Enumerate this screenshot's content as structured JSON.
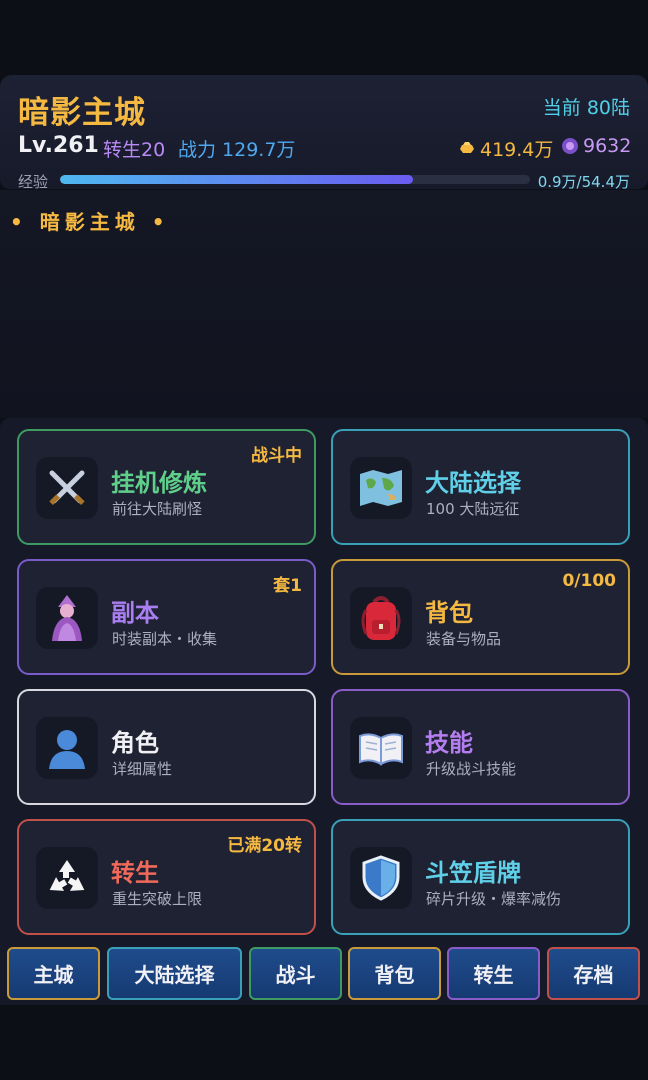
{
  "header": {
    "city_title": "暗影主城",
    "continent": "当前 80陆",
    "level": "Lv.261",
    "rebirth": "转生20",
    "power": "战力 129.7万",
    "gold": "419.4万",
    "gems": "9632",
    "exp_label": "经验",
    "exp_text": "0.9万/54.4万",
    "exp_progress": 0.75
  },
  "scene": {
    "title": "• 暗影主城 •"
  },
  "cards": [
    {
      "title": "挂机修炼",
      "sub": "前往大陆刷怪",
      "badge": "战斗中",
      "icon": "crossed-swords-icon",
      "color": "#5fd08a",
      "border": "#3f9a62"
    },
    {
      "title": "大陆选择",
      "sub": "100 大陆远征",
      "badge": "",
      "icon": "world-map-icon",
      "color": "#5fd0e8",
      "border": "#3aa0b8"
    },
    {
      "title": "副本",
      "sub": "时装副本・收集",
      "badge": "套1",
      "icon": "mage-character-icon",
      "color": "#a97ef0",
      "border": "#7a5cc8"
    },
    {
      "title": "背包",
      "sub": "装备与物品",
      "badge": "0/100",
      "icon": "backpack-icon",
      "color": "#f5b942",
      "border": "#c99a3a"
    },
    {
      "title": "角色",
      "sub": "详细属性",
      "badge": "",
      "icon": "person-silhouette-icon",
      "color": "#f0f0f5",
      "border": "#d8d8e0"
    },
    {
      "title": "技能",
      "sub": "升级战斗技能",
      "badge": "",
      "icon": "open-book-icon",
      "color": "#b57ef0",
      "border": "#8a5cc8"
    },
    {
      "title": "转生",
      "sub": "重生突破上限",
      "badge": "已满20转",
      "icon": "recycle-icon",
      "color": "#f06a5a",
      "border": "#c0504a"
    },
    {
      "title": "斗笠盾牌",
      "sub": "碎片升级・爆率减伤",
      "badge": "",
      "icon": "shield-icon",
      "color": "#5fd0e8",
      "border": "#3aa0b8"
    }
  ],
  "nav": [
    {
      "label": "主城",
      "border": "#c99a3a"
    },
    {
      "label": "大陆选择",
      "border": "#3aa0b8"
    },
    {
      "label": "战斗",
      "border": "#3f9a62"
    },
    {
      "label": "背包",
      "border": "#c99a3a"
    },
    {
      "label": "转生",
      "border": "#8a5cc8"
    },
    {
      "label": "存档",
      "border": "#c0504a"
    }
  ]
}
